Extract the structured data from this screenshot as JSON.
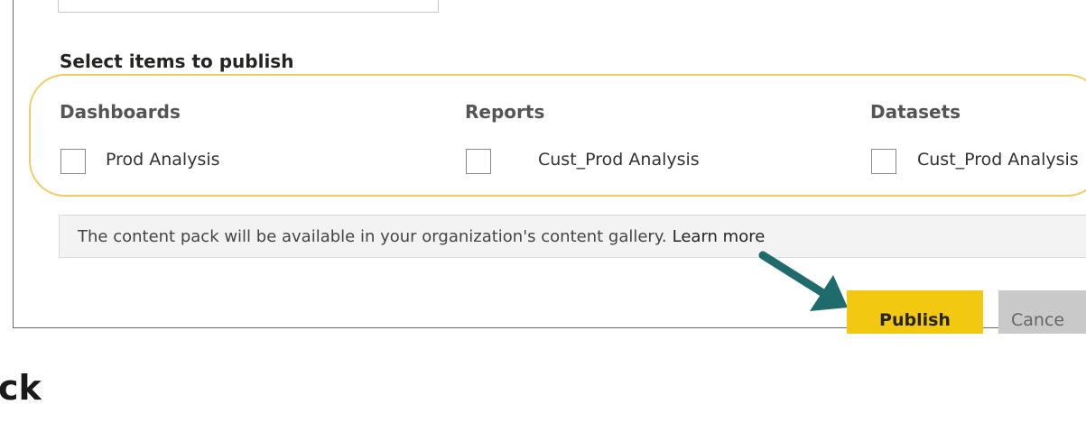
{
  "section": {
    "title": "Select items to publish"
  },
  "columns": [
    {
      "header": "Dashboards",
      "item": "Prod Analysis"
    },
    {
      "header": "Reports",
      "item": "Cust_Prod Analysis"
    },
    {
      "header": "Datasets",
      "item": "Cust_Prod Analysis"
    }
  ],
  "info": {
    "text": "The content pack will be available in your organization's content gallery.",
    "link": "Learn more"
  },
  "buttons": {
    "publish": "Publish",
    "cancel": "Cance"
  },
  "page_heading_fragment": "ck",
  "colors": {
    "highlight": "#f1cc63",
    "publish_bg": "#f2c811",
    "cancel_bg": "#c9c9c9",
    "arrow": "#1f6b6b"
  },
  "icons": {
    "pointer": "arrow-icon"
  }
}
